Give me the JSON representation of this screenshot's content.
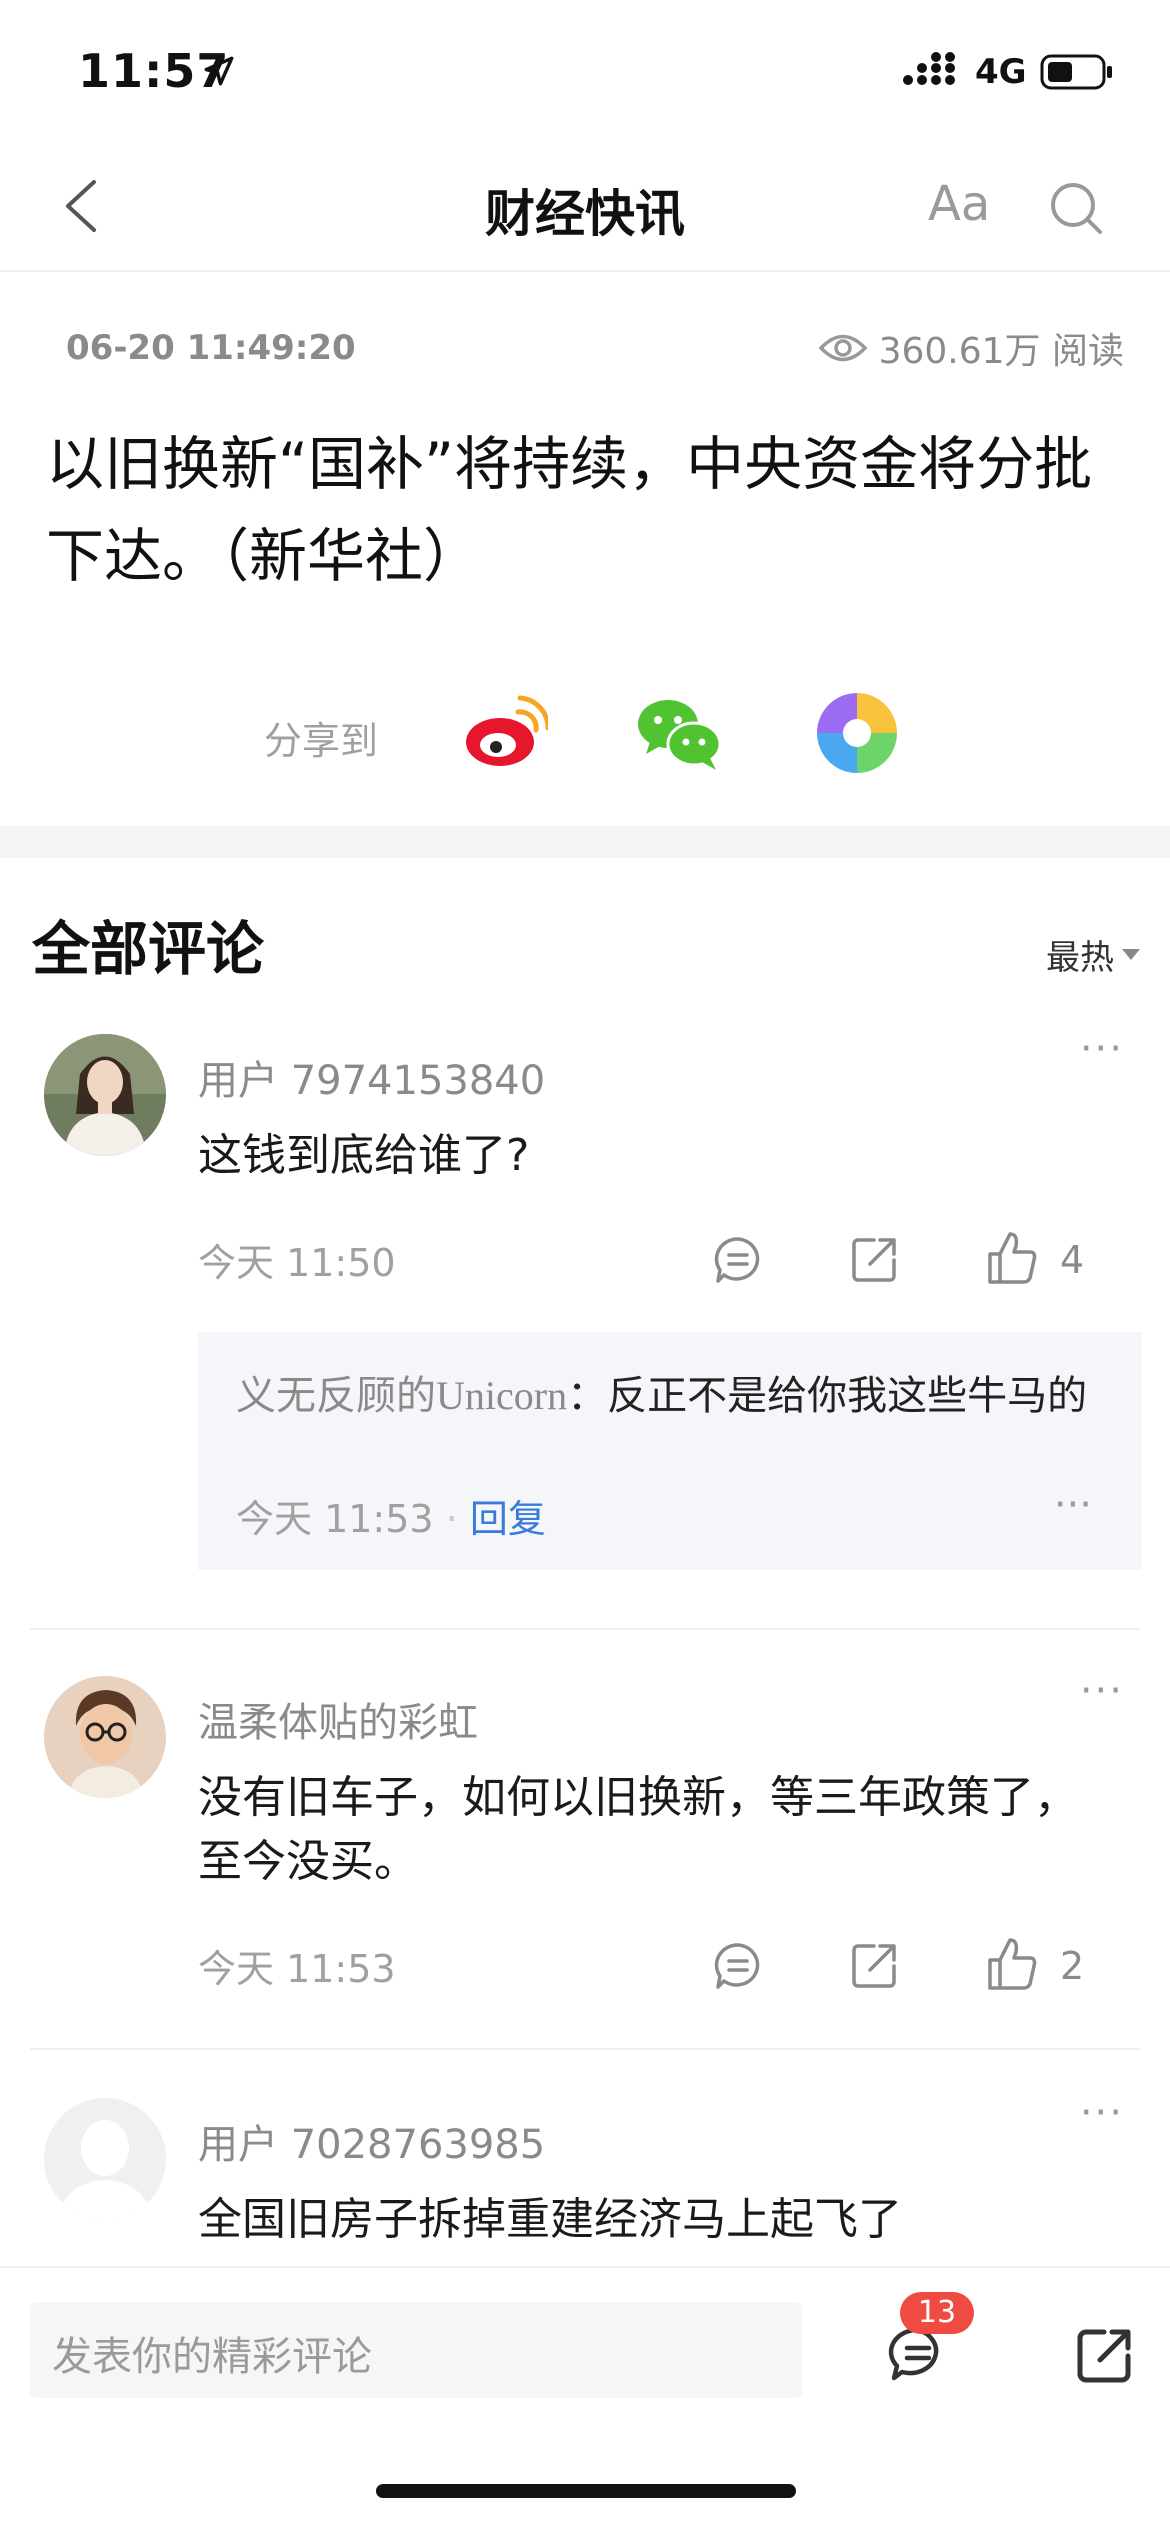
{
  "status_bar": {
    "time": "11:57",
    "network": "4G"
  },
  "nav": {
    "title": "财经快讯",
    "font_size_label": "Aa"
  },
  "article": {
    "datetime": "06-20 11:49:20",
    "views": "360.61万 阅读",
    "headline": "以旧换新“国补”将持续，中央资金将分批下达。（新华社）",
    "share_label": "分享到"
  },
  "comments_section": {
    "heading": "全部评论",
    "sort": "最热",
    "items": [
      {
        "user": "用户 7974153840",
        "text": "这钱到底给谁了?",
        "time": "今天 11:50",
        "likes": "4",
        "reply": {
          "name": "义无反顾的Unicorn",
          "text": "：反正不是给你我这些牛马的",
          "time": "今天 11:53",
          "link": "回复"
        }
      },
      {
        "user": "温柔体贴的彩虹",
        "text": "没有旧车子，如何以旧换新，等三年政策了，至今没买。",
        "time": "今天 11:53",
        "likes": "2"
      },
      {
        "user": "用户 7028763985",
        "text": "全国旧房子拆掉重建经济马上起飞了"
      }
    ]
  },
  "bottom_bar": {
    "placeholder": "发表你的精彩评论",
    "comment_count": "13"
  },
  "colors": {
    "link": "#3a7ad9",
    "badge": "#f04b43",
    "weibo": "#e6162d",
    "wechat": "#51c332"
  }
}
